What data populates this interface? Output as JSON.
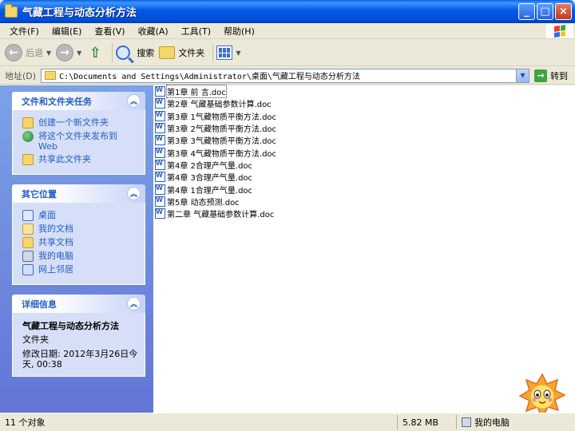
{
  "window": {
    "title": "气藏工程与动态分析方法",
    "buttons": {
      "minimize": "_",
      "maximize": "□",
      "close": "×"
    }
  },
  "menubar": {
    "items": [
      "文件(F)",
      "编辑(E)",
      "查看(V)",
      "收藏(A)",
      "工具(T)",
      "帮助(H)"
    ]
  },
  "toolbar": {
    "back": "后退",
    "search": "搜索",
    "folders": "文件夹"
  },
  "address": {
    "label": "地址(D)",
    "path": "C:\\Documents and Settings\\Administrator\\桌面\\气藏工程与动态分析方法",
    "go": "转到"
  },
  "tasks": {
    "title": "文件和文件夹任务",
    "items": [
      "创建一个新文件夹",
      "将这个文件夹发布到 Web",
      "共享此文件夹"
    ]
  },
  "places": {
    "title": "其它位置",
    "items": [
      "桌面",
      "我的文档",
      "共享文档",
      "我的电脑",
      "网上邻居"
    ]
  },
  "details": {
    "title": "详细信息",
    "name": "气藏工程与动态分析方法",
    "type": "文件夹",
    "modified": "修改日期: 2012年3月26日今天, 00:38"
  },
  "files": [
    "第1章  前 言.doc",
    "第2章 气藏基础参数计算.doc",
    "第3章  1气藏物质平衡方法.doc",
    "第3章  2气藏物质平衡方法.doc",
    "第3章  3气藏物质平衡方法.doc",
    "第3章  4气藏物质平衡方法.doc",
    "第4章 2合理产气量.doc",
    "第4章 3合理产气量.doc",
    "第4章  1合理产气量.doc",
    "第5章 动态预测.doc",
    "第二章 气藏基础参数计算.doc"
  ],
  "status": {
    "count": "11 个对象",
    "size": "5.82 MB",
    "zone": "我的电脑"
  },
  "colors": {
    "titlebar": "#0058e6",
    "taskpane": "#6f8fe0",
    "link": "#215dc6"
  }
}
